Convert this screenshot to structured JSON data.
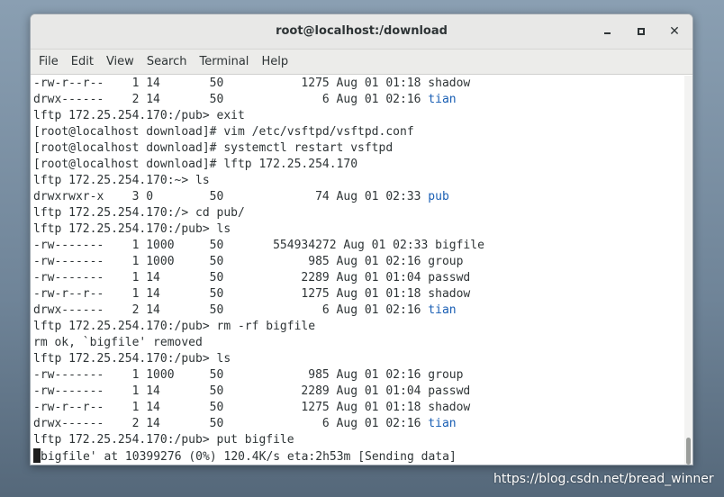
{
  "window": {
    "title": "root@localhost:/download"
  },
  "menubar": {
    "items": [
      "File",
      "Edit",
      "View",
      "Search",
      "Terminal",
      "Help"
    ]
  },
  "terminal": {
    "lines": [
      {
        "text": "-rw-r--r--    1 14       50           1275 Aug 01 01:18 shadow",
        "dir": ""
      },
      {
        "text": "drwx------    2 14       50              6 Aug 01 02:16 ",
        "dir": "tian"
      },
      {
        "text": "lftp 172.25.254.170:/pub> exit",
        "dir": ""
      },
      {
        "text": "[root@localhost download]# vim /etc/vsftpd/vsftpd.conf",
        "dir": ""
      },
      {
        "text": "[root@localhost download]# systemctl restart vsftpd",
        "dir": ""
      },
      {
        "text": "[root@localhost download]# lftp 172.25.254.170",
        "dir": ""
      },
      {
        "text": "lftp 172.25.254.170:~> ls",
        "dir": ""
      },
      {
        "text": "drwxrwxr-x    3 0        50             74 Aug 01 02:33 ",
        "dir": "pub"
      },
      {
        "text": "lftp 172.25.254.170:/> cd pub/",
        "dir": ""
      },
      {
        "text": "lftp 172.25.254.170:/pub> ls",
        "dir": ""
      },
      {
        "text": "-rw-------    1 1000     50       554934272 Aug 01 02:33 bigfile",
        "dir": ""
      },
      {
        "text": "-rw-------    1 1000     50            985 Aug 01 02:16 group",
        "dir": ""
      },
      {
        "text": "-rw-------    1 14       50           2289 Aug 01 01:04 passwd",
        "dir": ""
      },
      {
        "text": "-rw-r--r--    1 14       50           1275 Aug 01 01:18 shadow",
        "dir": ""
      },
      {
        "text": "drwx------    2 14       50              6 Aug 01 02:16 ",
        "dir": "tian"
      },
      {
        "text": "lftp 172.25.254.170:/pub> rm -rf bigfile",
        "dir": ""
      },
      {
        "text": "rm ok, `bigfile' removed",
        "dir": ""
      },
      {
        "text": "lftp 172.25.254.170:/pub> ls",
        "dir": ""
      },
      {
        "text": "-rw-------    1 1000     50            985 Aug 01 02:16 group",
        "dir": ""
      },
      {
        "text": "-rw-------    1 14       50           2289 Aug 01 01:04 passwd",
        "dir": ""
      },
      {
        "text": "-rw-r--r--    1 14       50           1275 Aug 01 01:18 shadow",
        "dir": ""
      },
      {
        "text": "drwx------    2 14       50              6 Aug 01 02:16 ",
        "dir": "tian"
      },
      {
        "text": "lftp 172.25.254.170:/pub> put bigfile",
        "dir": ""
      }
    ],
    "current_line": "bigfile' at 10399276 (0%) 120.4K/s eta:2h53m [Sending data]"
  },
  "colors": {
    "directory": "#1a5fb4",
    "text": "#2e3436"
  },
  "watermark": "https://blog.csdn.net/bread_winner"
}
